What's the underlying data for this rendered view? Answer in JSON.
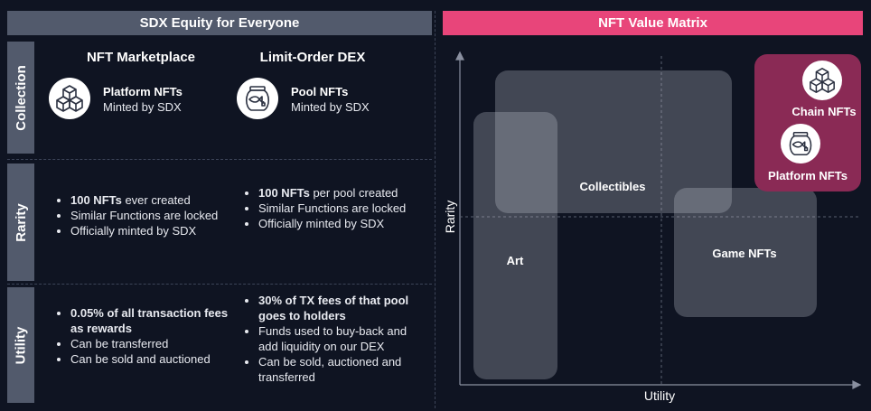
{
  "left_panel": {
    "title": "SDX Equity for Everyone",
    "header_color": "#525a6c",
    "row_labels": [
      "Collection",
      "Rarity",
      "Utility"
    ],
    "columns": [
      {
        "title": "NFT Marketplace",
        "icon": "cubes-icon",
        "collection_title": "Platform NFTs",
        "collection_sub": "Minted by SDX",
        "rarity": [
          {
            "bold": "100 NFTs",
            "text": " ever created"
          },
          {
            "bold": "",
            "text": "Similar Functions are locked"
          },
          {
            "bold": "",
            "text": "Officially minted by SDX"
          }
        ],
        "utility": [
          {
            "bold": "0.05% of all transaction fees as rewards",
            "text": ""
          },
          {
            "bold": "",
            "text": "Can be transferred"
          },
          {
            "bold": "",
            "text": "Can be sold and auctioned"
          }
        ]
      },
      {
        "title": "Limit-Order DEX",
        "icon": "fishbowl-icon",
        "collection_title": "Pool NFTs",
        "collection_sub": "Minted by SDX",
        "rarity": [
          {
            "bold": "100 NFTs",
            "text": " per pool created"
          },
          {
            "bold": "",
            "text": "Similar Functions are locked"
          },
          {
            "bold": "",
            "text": "Officially minted by SDX"
          }
        ],
        "utility": [
          {
            "bold": "30% of TX fees of that pool goes to holders",
            "text": ""
          },
          {
            "bold": "",
            "text": "Funds used to buy-back and add liquidity on our DEX"
          },
          {
            "bold": "",
            "text": "Can be sold, auctioned and transferred"
          }
        ]
      }
    ]
  },
  "right_panel": {
    "title": "NFT Value Matrix",
    "header_color": "#e8457a",
    "x_label": "Utility",
    "y_label": "Rarity",
    "regions": [
      {
        "label": "Collectibles"
      },
      {
        "label": "Art"
      },
      {
        "label": "Game NFTs"
      }
    ],
    "highlight": {
      "color": "#8a2a55",
      "items": [
        {
          "label": "Chain NFTs",
          "icon": "cubes-icon"
        },
        {
          "label": "Platform NFTs",
          "icon": "fishbowl-icon"
        }
      ]
    }
  }
}
